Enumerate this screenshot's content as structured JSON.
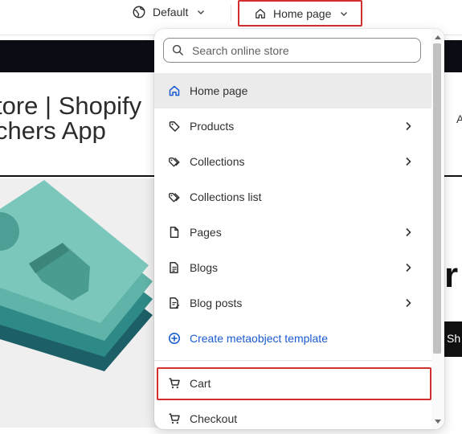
{
  "topbar": {
    "theme_label": "Default",
    "page_label": "Home page"
  },
  "preview": {
    "store_title_line1": "tore | Shopify",
    "store_title_line2": "chers App",
    "header_link": "A",
    "hero_letter": "r",
    "hero_button": "Sh"
  },
  "popover": {
    "search_placeholder": "Search online store",
    "items": [
      {
        "label": "Home page",
        "icon": "home-icon",
        "has_arrow": false,
        "active": true
      },
      {
        "label": "Products",
        "icon": "tag-icon",
        "has_arrow": true
      },
      {
        "label": "Collections",
        "icon": "tags-icon",
        "has_arrow": true
      },
      {
        "label": "Collections list",
        "icon": "tags-icon",
        "has_arrow": false
      },
      {
        "label": "Pages",
        "icon": "page-icon",
        "has_arrow": true
      },
      {
        "label": "Blogs",
        "icon": "blog-icon",
        "has_arrow": true
      },
      {
        "label": "Blog posts",
        "icon": "blog-post-icon",
        "has_arrow": true
      },
      {
        "label": "Create metaobject template",
        "icon": "plus-circle-icon",
        "has_arrow": false
      },
      {
        "label": "Cart",
        "icon": "cart-icon",
        "has_arrow": false
      },
      {
        "label": "Checkout",
        "icon": "cart-icon",
        "has_arrow": false
      }
    ]
  },
  "colors": {
    "highlight_border": "#d32f2f",
    "link_blue": "#1a5bd0",
    "active_bg": "#ebebeb",
    "announcement_bar": "#0a0e14",
    "hero_teal": "#5fb3a8"
  }
}
